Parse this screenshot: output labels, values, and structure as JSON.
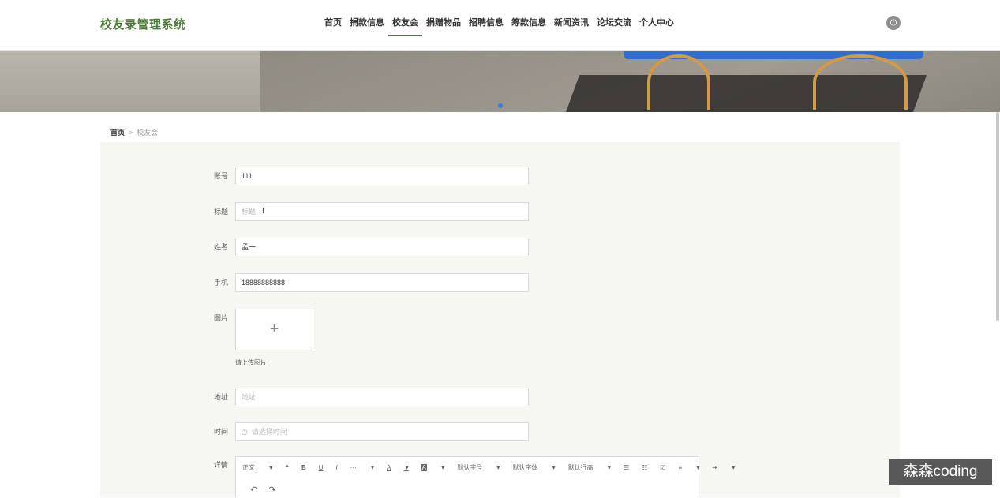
{
  "app": {
    "title": "校友录管理系统"
  },
  "nav": {
    "items": [
      {
        "label": "首页"
      },
      {
        "label": "捐款信息"
      },
      {
        "label": "校友会"
      },
      {
        "label": "捐赠物品"
      },
      {
        "label": "招聘信息"
      },
      {
        "label": "筹款信息"
      },
      {
        "label": "新闻资讯"
      },
      {
        "label": "论坛交流"
      },
      {
        "label": "个人中心"
      }
    ],
    "active": "校友会"
  },
  "breadcrumb": {
    "home": "首页",
    "separator": ">",
    "current": "校友会"
  },
  "form": {
    "account": {
      "label": "账号",
      "value": "111"
    },
    "title": {
      "label": "标题",
      "placeholder": "标题"
    },
    "name": {
      "label": "姓名",
      "value": "孟一"
    },
    "phone": {
      "label": "手机",
      "value": "18888888888"
    },
    "image": {
      "label": "图片",
      "hint": "请上传图片"
    },
    "address": {
      "label": "地址",
      "placeholder": "地址"
    },
    "time": {
      "label": "时间",
      "placeholder": "请选择时间"
    },
    "details": {
      "label": "详情"
    }
  },
  "editor": {
    "toolbar": [
      "正文",
      "❝",
      "B",
      "U",
      "I",
      "···",
      "A",
      "A",
      "默认字号",
      "默认字体",
      "默认行高",
      "☰",
      "☷",
      "☑",
      "≡",
      "⇥"
    ],
    "undo": "↶",
    "redo": "↷"
  },
  "watermark": "森森coding",
  "colors": {
    "logo": "#4a7a3a",
    "panel": "#f6f6f3",
    "nav_active_underline": "#5d6d5d"
  }
}
